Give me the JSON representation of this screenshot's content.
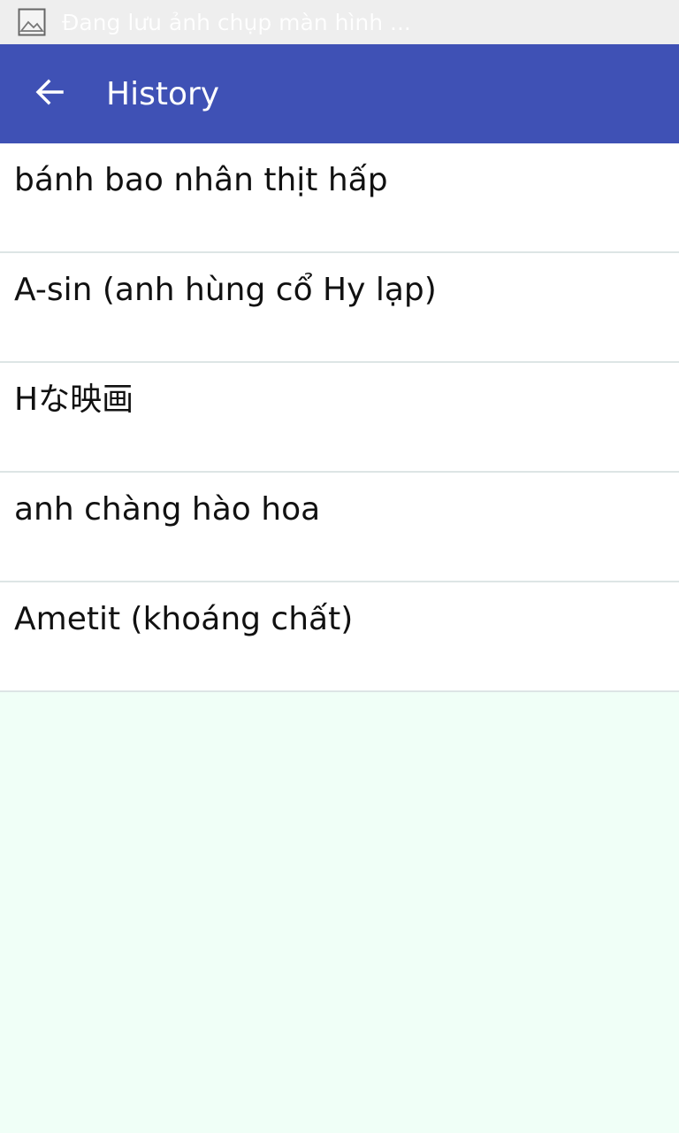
{
  "status_bar": {
    "notification_text": "Đang lưu ảnh chụp màn hình ...",
    "icon": "image-icon"
  },
  "app_bar": {
    "title": "History",
    "back_icon": "arrow-left-icon",
    "color": "#3f51b5"
  },
  "history": {
    "items": [
      "bánh bao nhân thịt hấp",
      "A-sin (anh hùng cổ Hy lạp)",
      "Hな映画",
      "anh chàng hào hoa",
      "Ametit (khoáng chất)"
    ]
  }
}
